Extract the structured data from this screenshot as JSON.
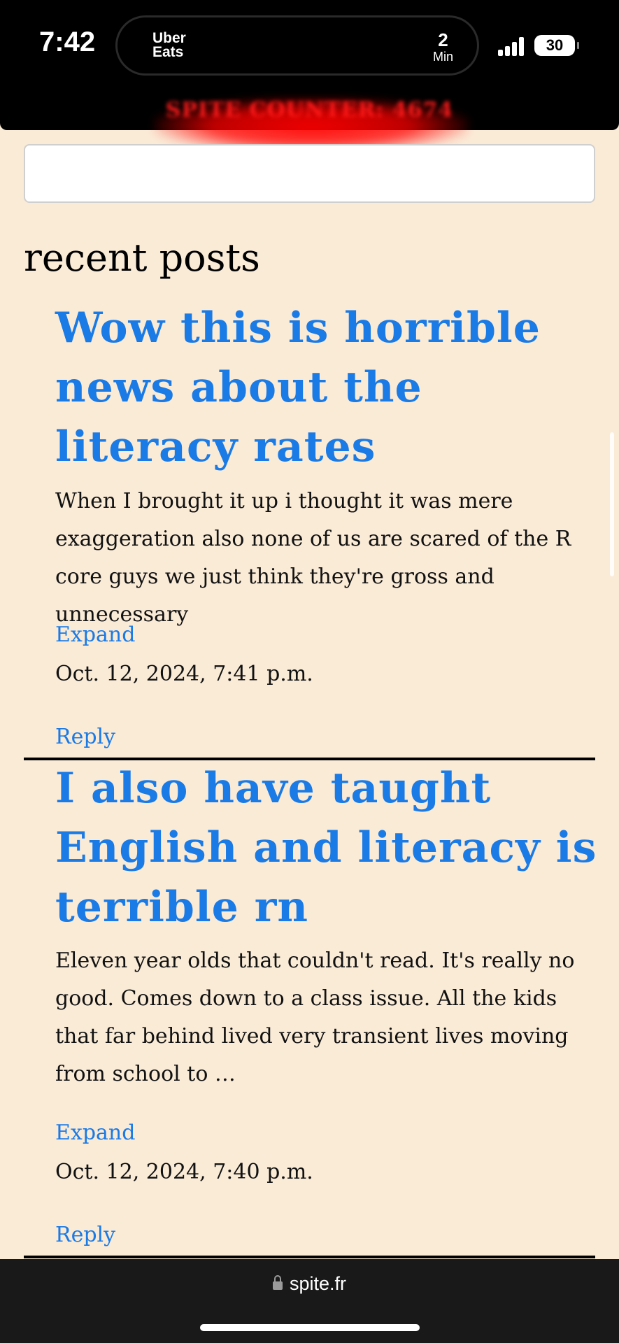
{
  "status_bar": {
    "time": "7:42",
    "live_activity": {
      "brand_line1": "Uber",
      "brand_line2": "Eats",
      "eta_value": "2",
      "eta_unit": "Min"
    },
    "battery": "30"
  },
  "banner": {
    "text": "SPITE COUNTER: 4674",
    "color": "#ff1a1a"
  },
  "search": {
    "placeholder": "",
    "value": ""
  },
  "section": {
    "heading": "recent posts"
  },
  "posts": [
    {
      "title": "Wow this is horrible news about the literacy rates",
      "body": "When I brought it up i thought it was mere exaggeration also none of us are scared of the R core guys we just think they're gross and unnecessary",
      "expand_label": "Expand",
      "date": "Oct. 12, 2024, 7:41 p.m.",
      "reply_label": "Reply"
    },
    {
      "title": "I also have taught English and literacy is terrible rn",
      "body": "Eleven year olds that couldn't read. It's really no good. Comes down to a class issue. All the kids that far behind lived very transient lives moving from school to …",
      "expand_label": "Expand",
      "date": "Oct. 12, 2024, 7:40 p.m.",
      "reply_label": "Reply"
    }
  ],
  "browser": {
    "url": "spite.fr"
  },
  "colors": {
    "background": "#faebd7",
    "link": "#1a7ae6",
    "text": "#111111"
  }
}
